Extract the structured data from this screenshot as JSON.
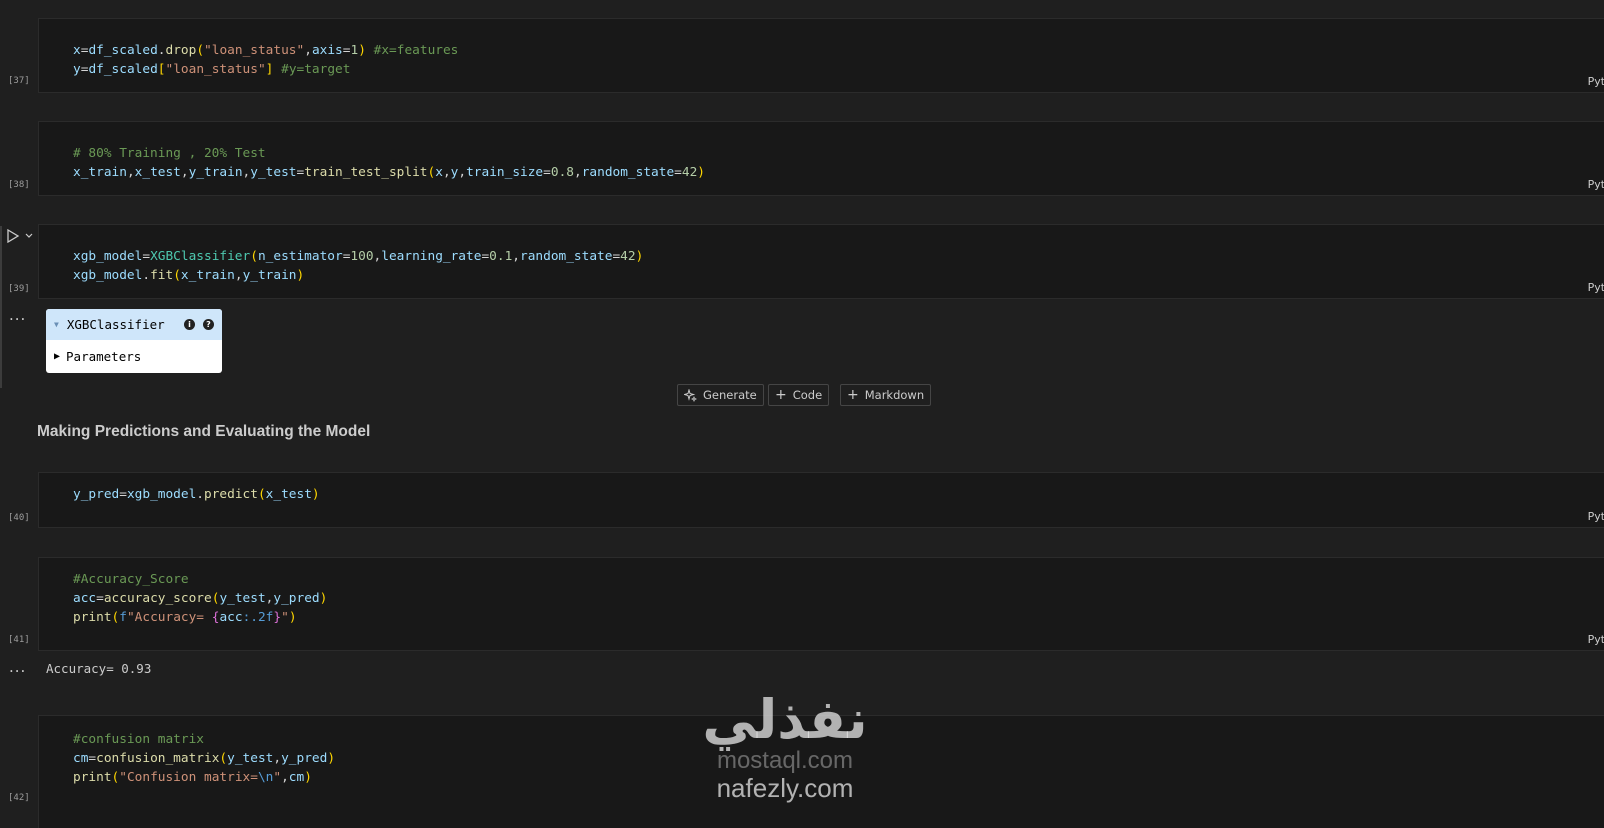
{
  "cells": [
    {
      "exec_count": "[37]",
      "lang": "Pyth",
      "lines": [
        "x=df_scaled.drop(\"loan_status\",axis=1) #x=features",
        "y=df_scaled[\"loan_status\"] #y=target"
      ]
    },
    {
      "exec_count": "[38]",
      "lang": "Pyth",
      "lines": [
        "# 80% Training , 20% Test",
        "x_train,x_test,y_train,y_test=train_test_split(x,y,train_size=0.8,random_state=42)"
      ]
    },
    {
      "exec_count": "[39]",
      "lang": "Pyth",
      "lines": [
        "xgb_model=XGBClassifier(n_estimator=100,learning_rate=0.1,random_state=42)",
        "xgb_model.fit(x_train,y_train)"
      ]
    },
    {
      "exec_count": "[40]",
      "lang": "Pyth",
      "lines": [
        "y_pred=xgb_model.predict(x_test)"
      ]
    },
    {
      "exec_count": "[41]",
      "lang": "Pyth",
      "lines": [
        "#Accuracy_Score",
        "acc=accuracy_score(y_test,y_pred)",
        "print(f\"Accuracy= {acc:.2f}\")"
      ]
    },
    {
      "exec_count": "[42]",
      "lang": "Pyth",
      "lines": [
        "#confusion matrix",
        "cm=confusion_matrix(y_test,y_pred)",
        "print(\"Confusion matrix=\\n\",cm)"
      ]
    }
  ],
  "widget": {
    "title": "XGBClassifier",
    "info_badge": "i",
    "help_badge": "?",
    "params_label": "Parameters"
  },
  "toolbar": {
    "generate": "Generate",
    "code": "Code",
    "markdown": "Markdown"
  },
  "markdown_heading": "Making Predictions and Evaluating the Model",
  "accuracy_output": "Accuracy= 0.93",
  "more_dots": "...",
  "watermark": {
    "arabic": "نفذلي",
    "line1": "mostaql.com",
    "line2": "nafezly.com"
  },
  "colors": {
    "background": "#1f1f1f",
    "cell_bg": "#181818",
    "widget_header": "#cfe6fa"
  }
}
